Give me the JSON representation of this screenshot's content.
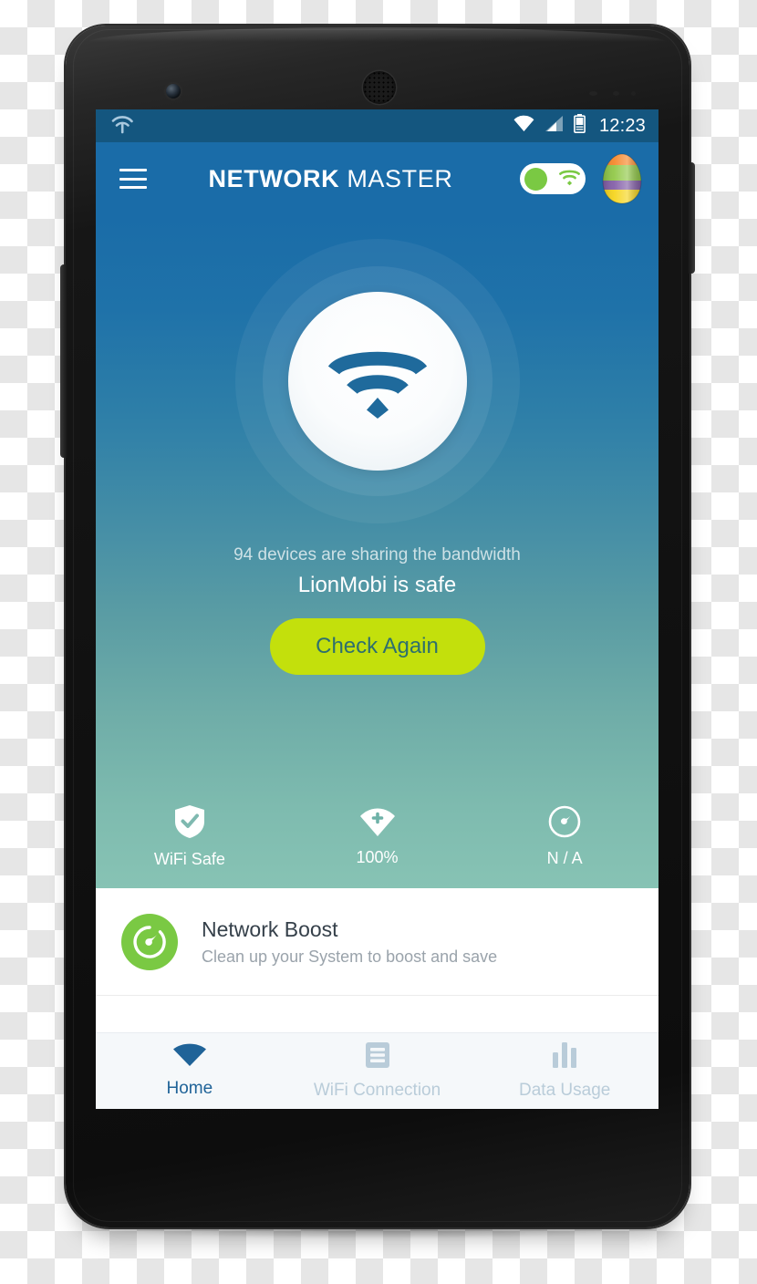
{
  "status_bar": {
    "notification_icon": "wifi-notification-icon",
    "wifi_icon": "wifi-signal-icon",
    "cellular_icon": "cellular-signal-icon",
    "battery_icon": "battery-icon",
    "clock": "12:23"
  },
  "app_bar": {
    "menu_icon": "hamburger-menu-icon",
    "title_bold": "NETWORK",
    "title_light": " MASTER",
    "wifi_toggle_state": "on",
    "wifi_toggle_icon": "wifi-icon",
    "avatar_icon": "easter-egg-avatar"
  },
  "hero": {
    "radar_icon": "wifi-scan-icon",
    "subtitle": "94 devices are sharing the bandwidth",
    "title": "LionMobi is safe",
    "check_again_label": "Check Again"
  },
  "stats": [
    {
      "icon": "shield-check-icon",
      "label": "WiFi Safe"
    },
    {
      "icon": "wifi-plus-icon",
      "label": "100%"
    },
    {
      "icon": "speedometer-icon",
      "label": "N / A"
    }
  ],
  "boost_card": {
    "icon": "boost-speed-icon",
    "title": "Network Boost",
    "subtitle": "Clean up your System to boost and save"
  },
  "bottom_nav": [
    {
      "icon": "wifi-home-icon",
      "label": "Home",
      "active": true
    },
    {
      "icon": "list-document-icon",
      "label": "WiFi Connection",
      "active": false
    },
    {
      "icon": "bar-chart-icon",
      "label": "Data Usage",
      "active": false
    }
  ],
  "colors": {
    "status_bar": "#14567f",
    "app_bar": "#1a6ca8",
    "hero_top": "#1a6ca8",
    "hero_bottom": "#87c3b4",
    "accent_green": "#7ac943",
    "button_lime": "#c3e00c",
    "button_text": "#2e6f6e",
    "nav_active": "#1f6398",
    "nav_inactive": "#b9ccd9"
  }
}
